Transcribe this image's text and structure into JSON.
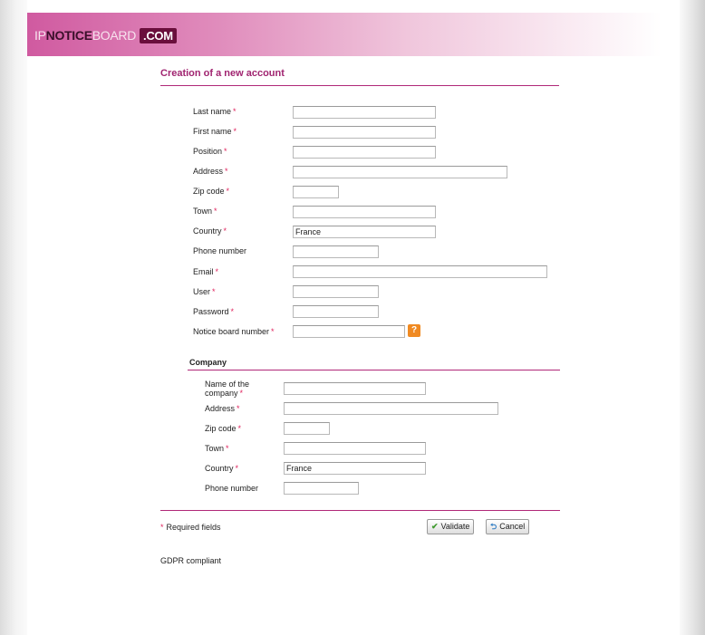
{
  "header": {
    "logo_part1": "IP",
    "logo_part2": "NOTICE",
    "logo_part3": "BOARD",
    "logo_dotcom": ".COM"
  },
  "page_title": "Creation of a new account",
  "required_marker": "*",
  "personal": {
    "last_name": {
      "label": "Last name",
      "value": ""
    },
    "first_name": {
      "label": "First name",
      "value": ""
    },
    "position": {
      "label": "Position",
      "value": ""
    },
    "address": {
      "label": "Address",
      "value": ""
    },
    "zip_code": {
      "label": "Zip code",
      "value": ""
    },
    "town": {
      "label": "Town",
      "value": ""
    },
    "country": {
      "label": "Country",
      "value": "France"
    },
    "phone": {
      "label": "Phone number",
      "value": ""
    },
    "email": {
      "label": "Email",
      "value": ""
    },
    "user": {
      "label": "User",
      "value": ""
    },
    "password": {
      "label": "Password",
      "value": ""
    },
    "notice_board_number": {
      "label": "Notice board number",
      "value": ""
    },
    "help_icon_glyph": "?"
  },
  "company": {
    "section_title": "Company",
    "name": {
      "label_line1": "Name of the",
      "label_line2": "company",
      "value": ""
    },
    "address": {
      "label": "Address",
      "value": ""
    },
    "zip_code": {
      "label": "Zip code",
      "value": ""
    },
    "town": {
      "label": "Town",
      "value": ""
    },
    "country": {
      "label": "Country",
      "value": "France"
    },
    "phone": {
      "label": "Phone number",
      "value": ""
    }
  },
  "footer": {
    "required_note": "Required fields",
    "validate_label": "Validate",
    "cancel_label": "Cancel",
    "check_icon_glyph": "✔",
    "cancel_icon_glyph": "⮌",
    "gdpr": "GDPR compliant"
  },
  "colors": {
    "accent": "#b02878",
    "required": "#e0245e",
    "help_icon": "#f08a22"
  }
}
